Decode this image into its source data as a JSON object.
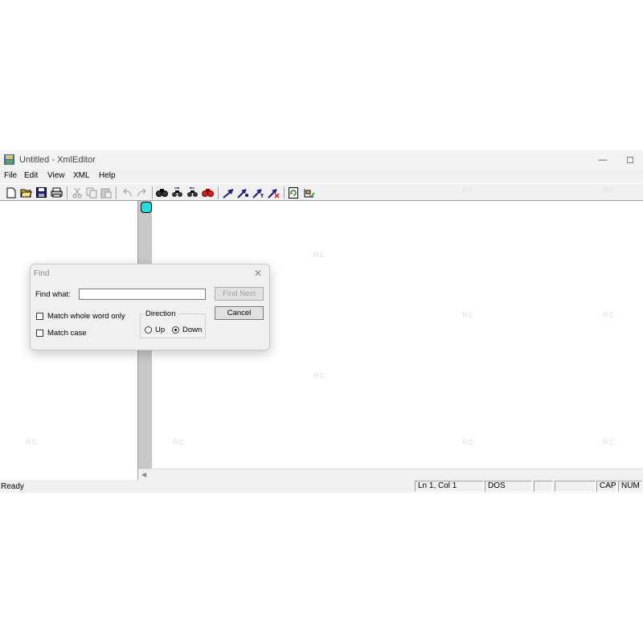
{
  "window": {
    "title": "Untitled - XmlEditor",
    "minimize_glyph": "—",
    "maximize_glyph": "☐"
  },
  "menu": [
    "File",
    "Edit",
    "View",
    "XML",
    "Help"
  ],
  "toolbar": {
    "groups": [
      [
        "new-icon",
        "open-icon",
        "save-icon",
        "print-icon"
      ],
      [
        "cut-icon",
        "copy-icon",
        "paste-icon"
      ],
      [
        "undo-icon",
        "redo-icon"
      ],
      [
        "find-icon",
        "find-next-icon",
        "find-previous-icon",
        "replace-icon"
      ],
      [
        "insert-element-icon",
        "insert-attribute-icon",
        "insert-text-icon",
        "delete-node-icon"
      ],
      [
        "refresh-icon",
        "validate-icon"
      ]
    ]
  },
  "watermark": "RC",
  "status": {
    "ready": "Ready",
    "position": "Ln 1, Col 1",
    "line_endings": "DOS",
    "caps": "CAP",
    "num": "NUM"
  },
  "find_dialog": {
    "title": "Find",
    "close_glyph": "✕",
    "find_what_label": "Find what:",
    "find_what_value": "",
    "find_next_label": "Find Next",
    "cancel_label": "Cancel",
    "match_whole_word_label": "Match whole word only",
    "match_whole_word_checked": false,
    "match_case_label": "Match case",
    "match_case_checked": false,
    "direction_label": "Direction",
    "up_label": "Up",
    "down_label": "Down",
    "direction_selected": "Down"
  },
  "colors": {
    "node_marker": "#22dede",
    "splitter": "#c8c8c8"
  }
}
